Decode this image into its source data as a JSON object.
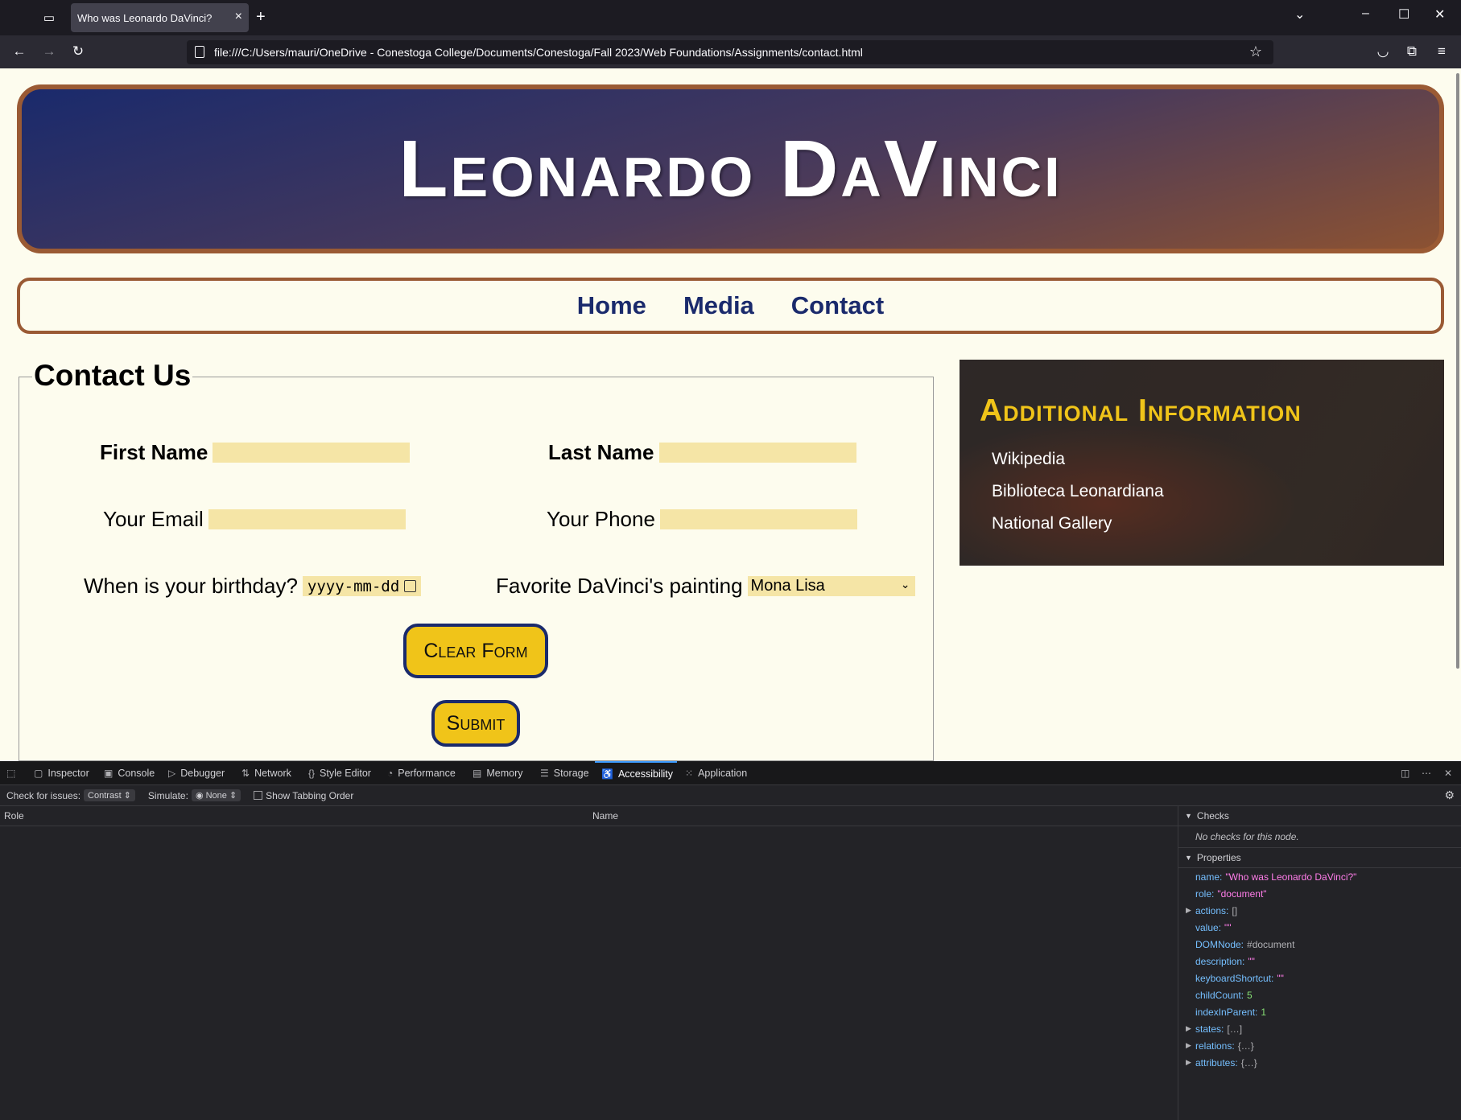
{
  "browser": {
    "tab_title": "Who was Leonardo DaVinci?",
    "url": "file:///C:/Users/mauri/OneDrive - Conestoga College/Documents/Conestoga/Fall 2023/Web Foundations/Assignments/contact.html"
  },
  "site": {
    "title": "Leonardo DaVinci",
    "nav": [
      "Home",
      "Media",
      "Contact"
    ]
  },
  "form": {
    "legend": "Contact Us",
    "first_name_label": "First Name",
    "last_name_label": "Last Name",
    "email_label": "Your Email",
    "phone_label": "Your Phone",
    "birthday_label": "When is your birthday?",
    "birthday_placeholder": "yyyy-mm-dd",
    "painting_label": "Favorite DaVinci's painting",
    "painting_selected": "Mona Lisa",
    "clear_label": "Clear Form",
    "submit_label": "Submit"
  },
  "aside": {
    "title": "Additional Information",
    "links": [
      "Wikipedia",
      "Biblioteca Leonardiana",
      "National Gallery"
    ]
  },
  "devtools": {
    "tabs": [
      "Inspector",
      "Console",
      "Debugger",
      "Network",
      "Style Editor",
      "Performance",
      "Memory",
      "Storage",
      "Accessibility",
      "Application"
    ],
    "active_tab": "Accessibility",
    "check_for_issues_label": "Check for issues:",
    "check_value": "Contrast",
    "simulate_label": "Simulate:",
    "simulate_value": "None",
    "tabbing_label": "Show Tabbing Order",
    "col_role": "Role",
    "col_name": "Name",
    "checks_header": "Checks",
    "checks_note": "No checks for this node.",
    "properties_header": "Properties",
    "properties": [
      {
        "k": "name:",
        "v": "\"Who was Leonardo DaVinci?\"",
        "t": "str"
      },
      {
        "k": "role:",
        "v": "\"document\"",
        "t": "str"
      },
      {
        "k": "actions:",
        "v": "[]",
        "t": "obj",
        "expand": true
      },
      {
        "k": "value:",
        "v": "\"\"",
        "t": "str"
      },
      {
        "k": "DOMNode:",
        "v": "#document",
        "t": "obj"
      },
      {
        "k": "description:",
        "v": "\"\"",
        "t": "str"
      },
      {
        "k": "keyboardShortcut:",
        "v": "\"\"",
        "t": "str"
      },
      {
        "k": "childCount:",
        "v": "5",
        "t": "num"
      },
      {
        "k": "indexInParent:",
        "v": "1",
        "t": "num"
      },
      {
        "k": "states:",
        "v": "[…]",
        "t": "obj",
        "expand": true
      },
      {
        "k": "relations:",
        "v": "{…}",
        "t": "obj",
        "expand": true
      },
      {
        "k": "attributes:",
        "v": "{…}",
        "t": "obj",
        "expand": true
      }
    ]
  }
}
